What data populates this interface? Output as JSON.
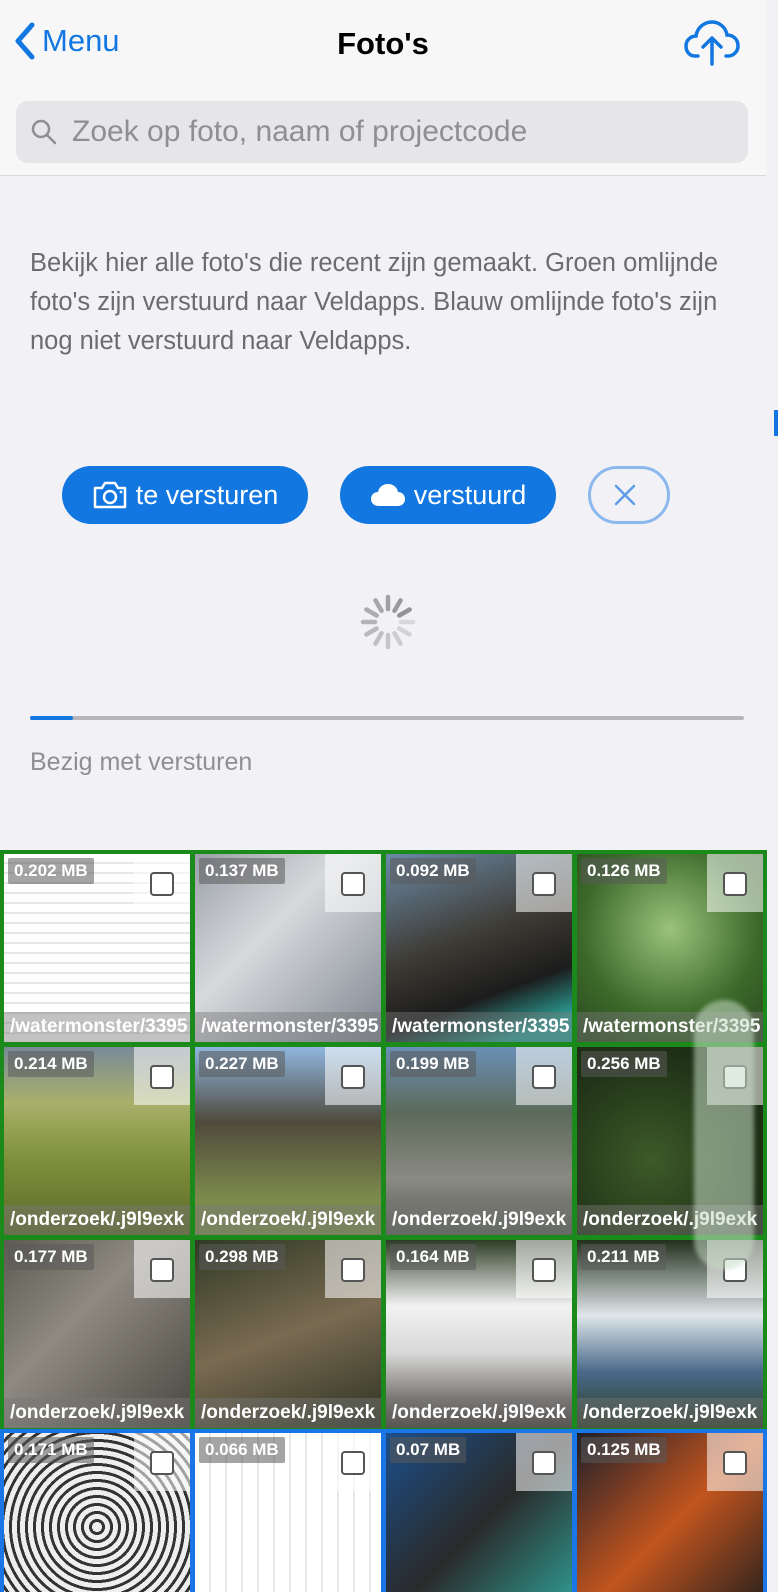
{
  "header": {
    "back_label": "Menu",
    "title": "Foto's",
    "upload_icon": "cloud-upload-icon"
  },
  "search": {
    "placeholder": "Zoek op foto, naam of projectcode",
    "value": ""
  },
  "intro": "Bekijk hier alle foto's die recent zijn gemaakt. Groen omlijnde foto's zijn verstuurd naar Veldapps. Blauw omlijnde foto's zijn nog niet verstuurd naar Veldapps.",
  "filters": {
    "to_send_label": "te versturen",
    "sent_label": "verstuurd",
    "clear_icon": "close-icon"
  },
  "progress": {
    "fraction": 0.06,
    "status_label": "Bezig met versturen"
  },
  "colors": {
    "accent": "#1277e0",
    "sent_border": "#1a8a1a",
    "unsent_border": "#1a76e6"
  },
  "photos": [
    {
      "size": "0.202 MB",
      "path": "/watermonster/3395",
      "status": "sent"
    },
    {
      "size": "0.137 MB",
      "path": "/watermonster/3395",
      "status": "sent"
    },
    {
      "size": "0.092 MB",
      "path": "/watermonster/3395",
      "status": "sent"
    },
    {
      "size": "0.126 MB",
      "path": "/watermonster/3395",
      "status": "sent"
    },
    {
      "size": "0.214 MB",
      "path": "/onderzoek/.j9l9exk",
      "status": "sent"
    },
    {
      "size": "0.227 MB",
      "path": "/onderzoek/.j9l9exk",
      "status": "sent"
    },
    {
      "size": "0.199 MB",
      "path": "/onderzoek/.j9l9exk",
      "status": "sent"
    },
    {
      "size": "0.256 MB",
      "path": "/onderzoek/.j9l9exk",
      "status": "sent"
    },
    {
      "size": "0.177 MB",
      "path": "/onderzoek/.j9l9exk",
      "status": "sent"
    },
    {
      "size": "0.298 MB",
      "path": "/onderzoek/.j9l9exk",
      "status": "sent"
    },
    {
      "size": "0.164 MB",
      "path": "/onderzoek/.j9l9exk",
      "status": "sent"
    },
    {
      "size": "0.211 MB",
      "path": "/onderzoek/.j9l9exk",
      "status": "sent"
    },
    {
      "size": "0.171 MB",
      "path": "",
      "status": "unsent"
    },
    {
      "size": "0.066 MB",
      "path": "",
      "status": "unsent"
    },
    {
      "size": "0.07 MB",
      "path": "",
      "status": "unsent"
    },
    {
      "size": "0.125 MB",
      "path": "",
      "status": "unsent"
    }
  ]
}
